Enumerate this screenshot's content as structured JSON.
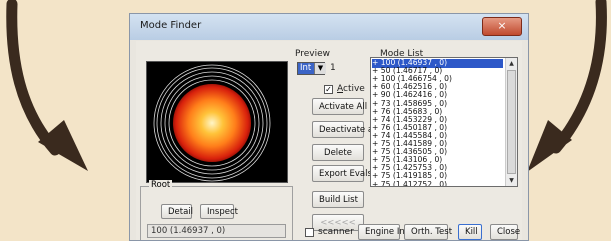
{
  "window": {
    "title": "Mode Finder",
    "close_symbol": "×"
  },
  "preview": {
    "label": "Preview",
    "mode_select": {
      "value": "Int",
      "arrow": "▼"
    },
    "count": "1",
    "active_label": "Active",
    "active_checked": true
  },
  "buttons": {
    "activate_all": "Activate All",
    "deactivate_all": "Deactivate all",
    "delete": "Delete",
    "export_evals": "Export Evals",
    "build_list": "Build List",
    "disabled_btn": "<<<<<",
    "engine_info": "Engine Info",
    "orth_test": "Orth. Test",
    "kill": "Kill",
    "close": "Close"
  },
  "root": {
    "label": "Root",
    "detail": "Detail",
    "inspect": "Inspect",
    "value": "100 (1.46937 , 0)"
  },
  "scanner": {
    "label": "scanner",
    "checked": false
  },
  "mode_list": {
    "label": "Mode List",
    "items": [
      "+ 100 (1.46937 , 0)",
      "+ 50 (1.46717 , 0)",
      "+ 100 (1.466754 , 0)",
      "+ 60 (1.462516 , 0)",
      "+ 90 (1.462416 , 0)",
      "+ 73 (1.458695 , 0)",
      "+ 76 (1.45683 , 0)",
      "+ 74 (1.453229 , 0)",
      "+ 76 (1.450187 , 0)",
      "+ 74 (1.445584 , 0)",
      "+ 75 (1.441589 , 0)",
      "+ 75 (1.436505 , 0)",
      "+ 75 (1.43106 , 0)",
      "+ 75 (1.425753 , 0)",
      "+ 75 (1.419185 , 0)",
      "+ 75 (1.412752 , 0)"
    ],
    "selected_index": 0,
    "scroll_up": "▲",
    "scroll_down": "▼"
  },
  "colors": {
    "background": "#f3e4c8",
    "arrow": "#3a2a1e",
    "selection": "#2d58c8",
    "field_center": "#fff6c8",
    "field_mid": "#ff8a1c",
    "field_edge": "#d8200c"
  }
}
